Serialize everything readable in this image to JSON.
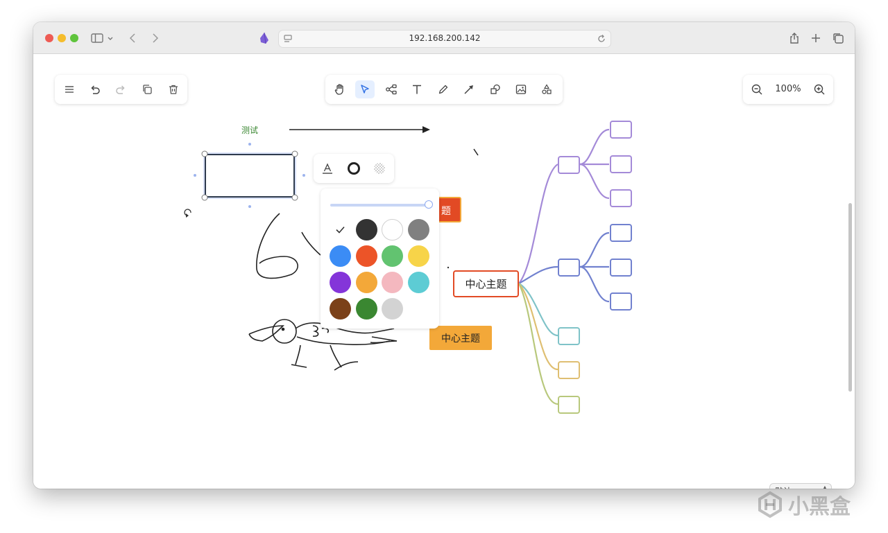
{
  "browser": {
    "url": "192.168.200.142"
  },
  "toolbar_left": {
    "buttons": [
      "menu-icon",
      "undo-icon",
      "redo-icon",
      "copy-icon",
      "delete-icon"
    ]
  },
  "toolbar_main": {
    "tools": [
      "hand-icon",
      "select-icon",
      "mindmap-icon",
      "text-icon",
      "pencil-icon",
      "arrow-icon",
      "shape-icon",
      "image-icon",
      "more-shapes-icon"
    ],
    "active_tool": "select-icon"
  },
  "zoom": {
    "value": "100%"
  },
  "canvas": {
    "label_test": "测试",
    "node_red_partial": "题",
    "central_topic": "中心主题",
    "orange_topic": "中心主题"
  },
  "style_popup": {
    "buttons": [
      "text-color-icon",
      "stroke-icon",
      "fill-transparent-icon"
    ],
    "opacity": 1.0,
    "selected_color": "none",
    "colors": [
      "none",
      "#333333",
      "#ffffff",
      "#808080",
      "#3b8cf5",
      "#ec5428",
      "#62c370",
      "#f7d449",
      "#8435d9",
      "#f3a839",
      "#f4b8bf",
      "#5dccd4",
      "#7b4119",
      "#3a8731",
      "#d3d3d3"
    ]
  },
  "mindmap": {
    "branch_colors": [
      "#a48ad8",
      "#7181cf",
      "#7fc3c8",
      "#dfbf72",
      "#b8c87c"
    ]
  },
  "statusbar": {
    "select_value": "默认"
  },
  "watermark": {
    "text": "小黑盒"
  }
}
